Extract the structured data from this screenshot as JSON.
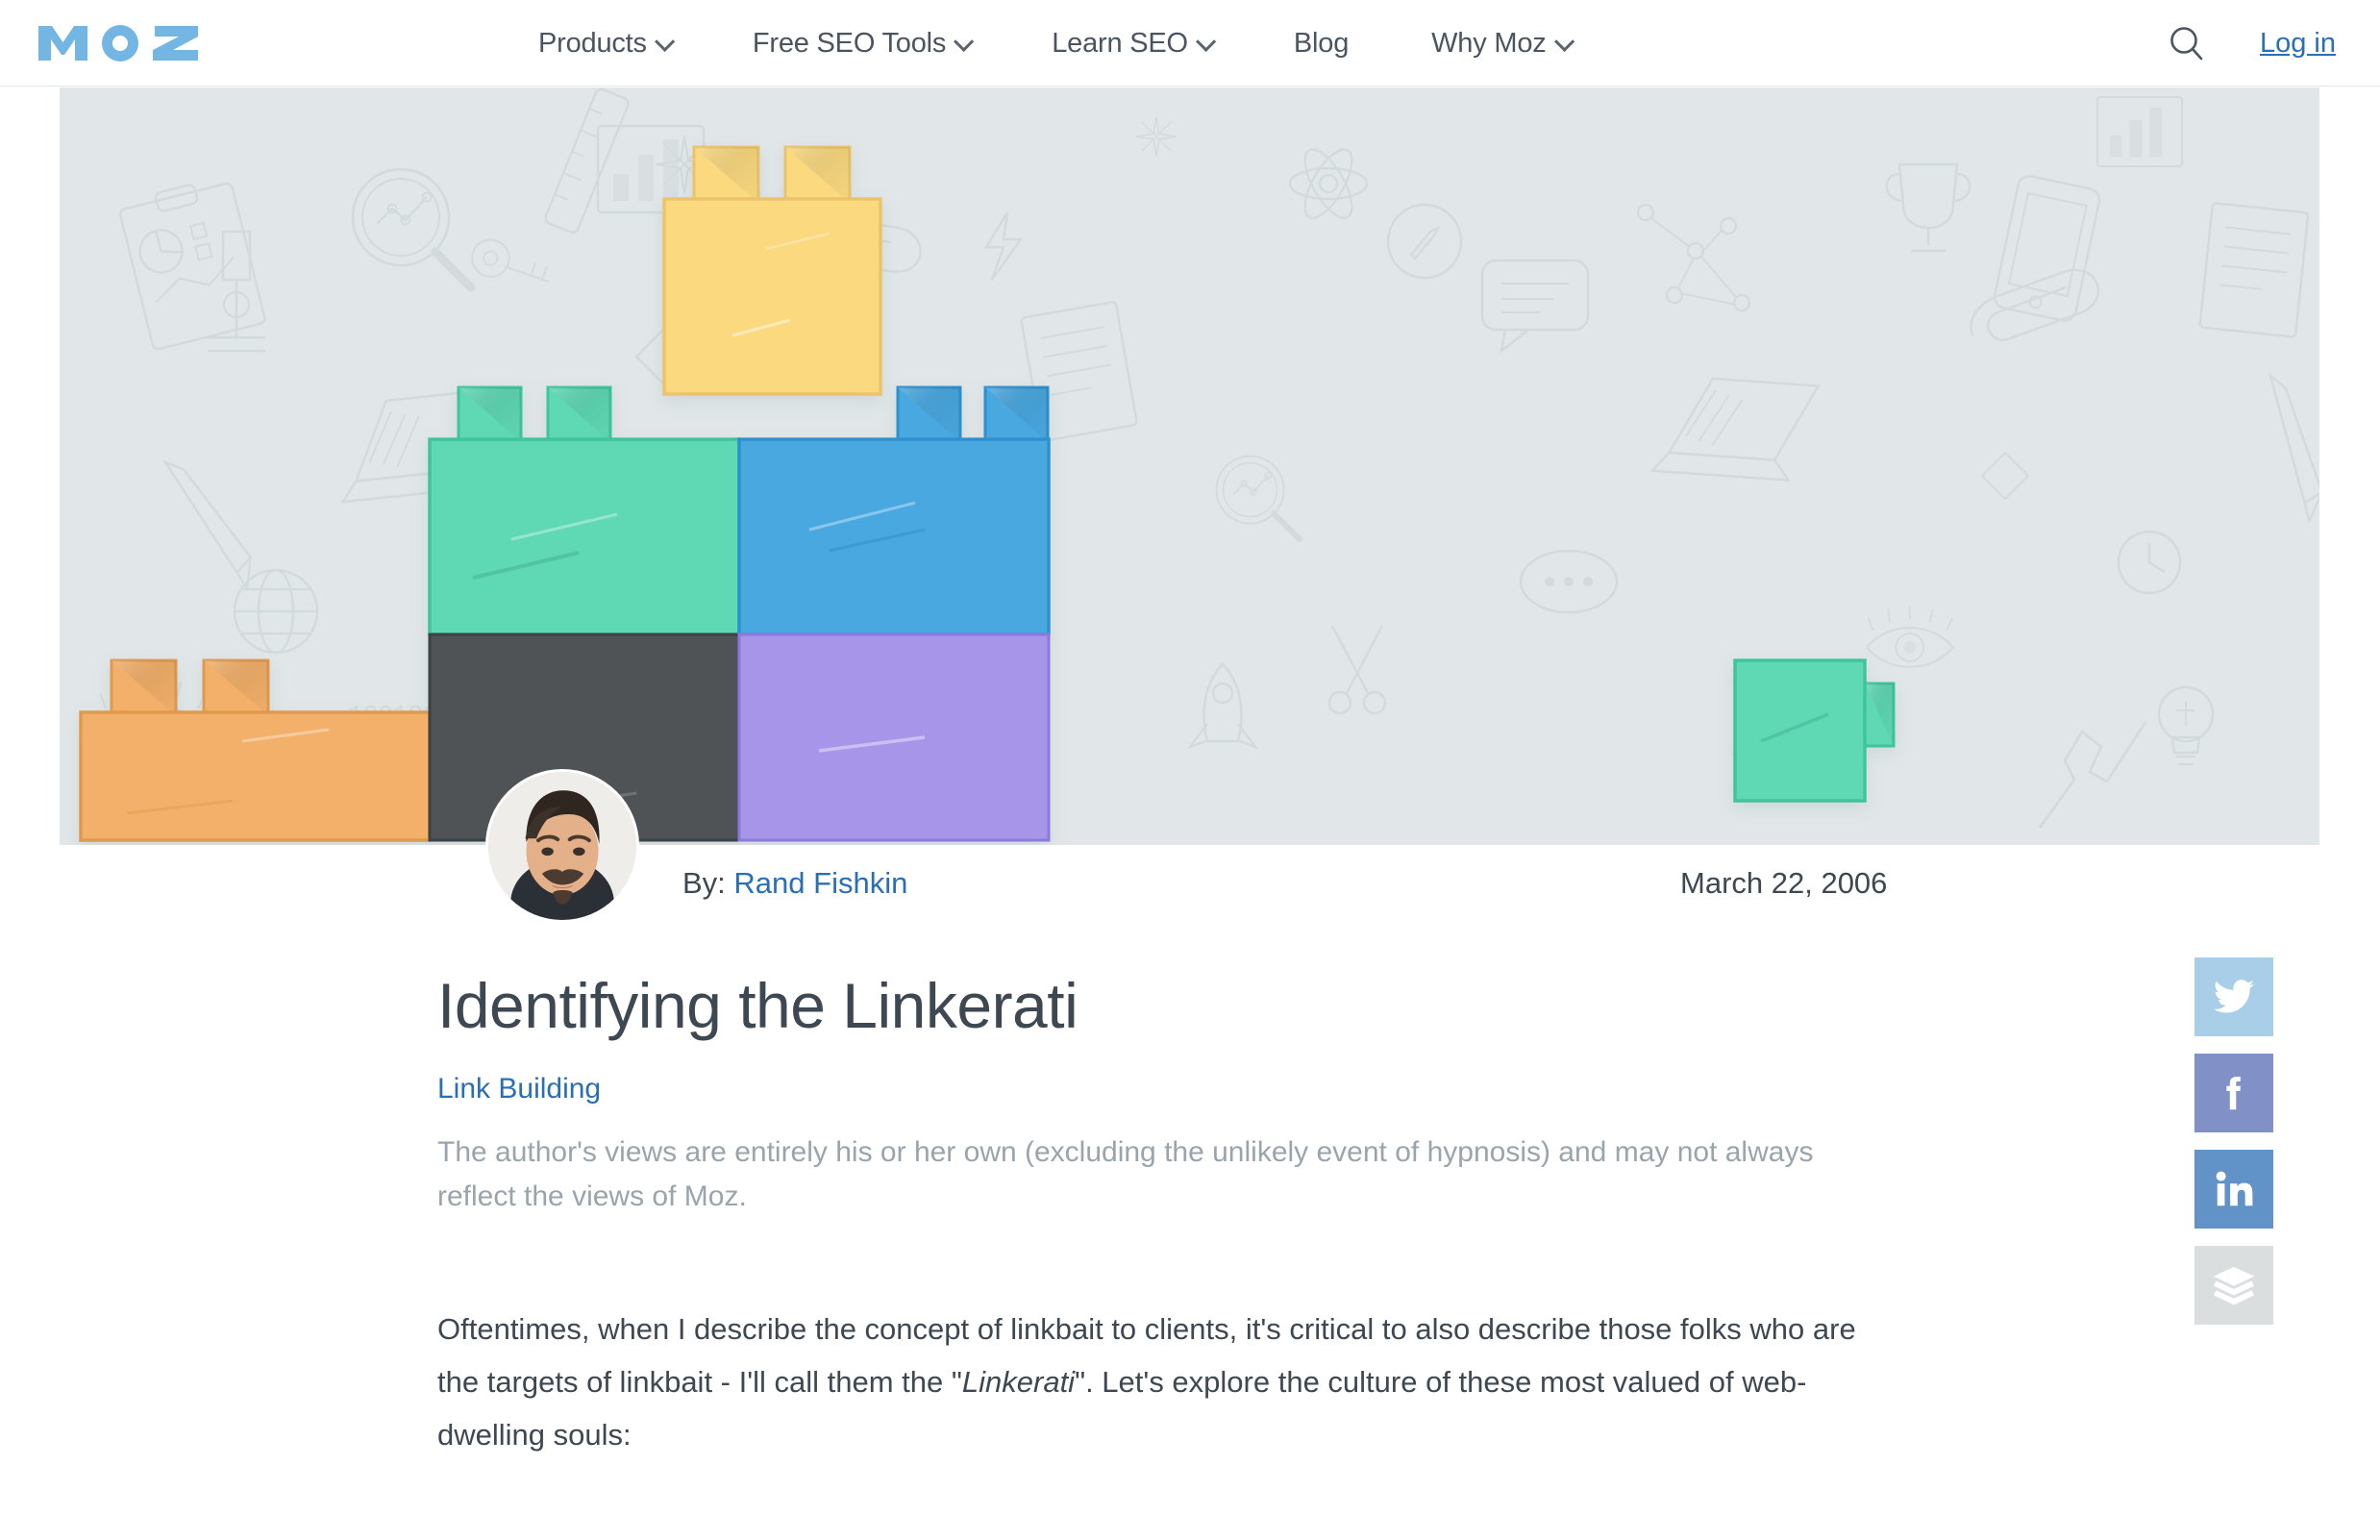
{
  "site": {
    "brand_name": "MOZ",
    "brand_color": "#74b6e3"
  },
  "nav": {
    "items": [
      {
        "label": "Products",
        "has_dropdown": true
      },
      {
        "label": "Free SEO Tools",
        "has_dropdown": true
      },
      {
        "label": "Learn SEO",
        "has_dropdown": true
      },
      {
        "label": "Blog",
        "has_dropdown": false
      },
      {
        "label": "Why Moz",
        "has_dropdown": true
      }
    ],
    "search_icon": "search-icon",
    "login_label": "Log in",
    "login_color": "#2a6fb5"
  },
  "hero": {
    "background_color": "#e1e7e8",
    "alt": "Illustration of stacked lego bricks on a faint doodle background",
    "bricks": [
      {
        "name": "yellow-brick",
        "color": "#fad97f"
      },
      {
        "name": "teal-brick",
        "color": "#5fd9b4"
      },
      {
        "name": "blue-brick",
        "color": "#49a8e0"
      },
      {
        "name": "orange-brick",
        "color": "#f3b06a"
      },
      {
        "name": "dark-brick",
        "color": "#4f5356"
      },
      {
        "name": "purple-brick",
        "color": "#a695e8"
      },
      {
        "name": "teal-brick-2",
        "color": "#5fd9b4"
      }
    ]
  },
  "post": {
    "author_prefix": "By:",
    "author_name": "Rand Fishkin",
    "published_date": "March 22, 2006",
    "title": "Identifying the Linkerati",
    "category": "Link Building",
    "disclaimer": "The author's views are entirely his or her own (excluding the unlikely event of hypnosis) and may not always reflect the views of Moz.",
    "body": {
      "part1": "Oftentimes, when I describe the concept of linkbait to clients, it's critical to also describe those folks who are the targets of linkbait - I'll call them the \"",
      "emphasis": "Linkerati",
      "part2": "\". Let's explore the culture of these most valued of web-dwelling souls:"
    }
  },
  "share": {
    "buttons": [
      {
        "name": "twitter",
        "label": "Twitter",
        "color": "#a9cfe8"
      },
      {
        "name": "facebook",
        "label": "Facebook",
        "color": "#8191c8"
      },
      {
        "name": "linkedin",
        "label": "LinkedIn",
        "color": "#6293c8"
      },
      {
        "name": "buffer",
        "label": "Buffer",
        "color": "#dadedf"
      }
    ]
  }
}
